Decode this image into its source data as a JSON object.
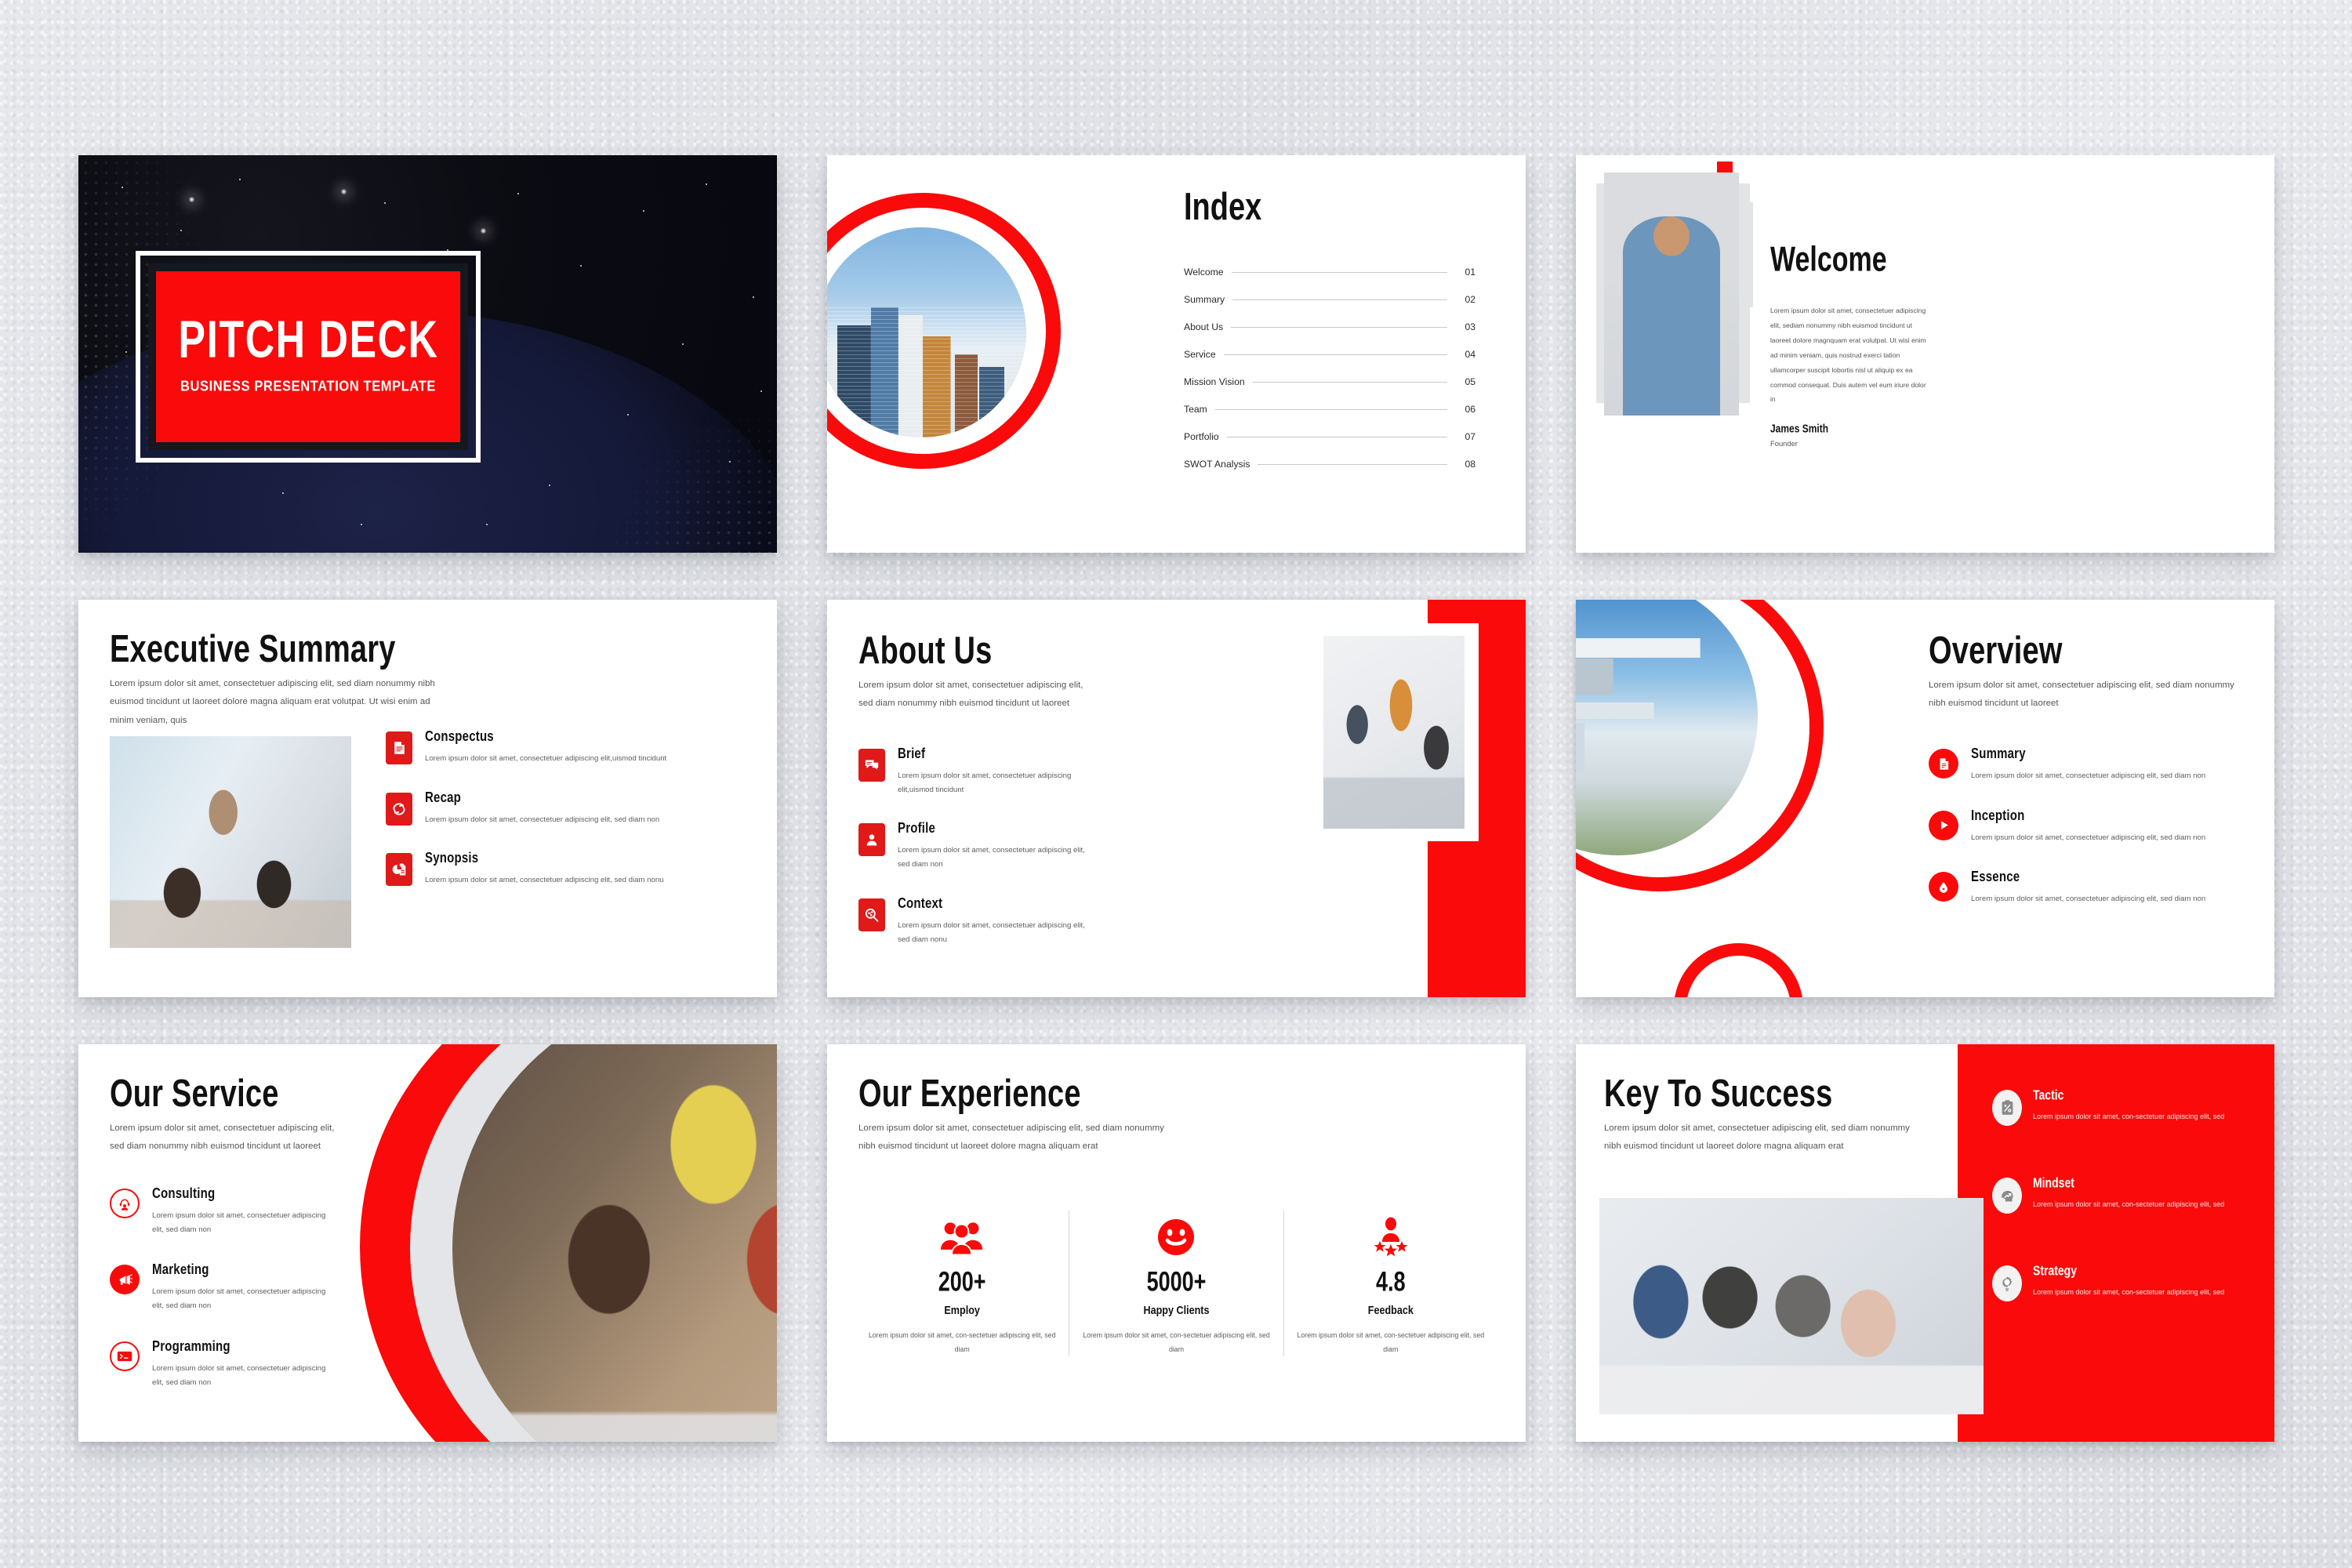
{
  "theme": {
    "red": "#FA0A0A",
    "dark_red": "#E01919",
    "ink": "#111111",
    "body_text": "#555555"
  },
  "slides": {
    "cover": {
      "title": "PITCH DECK",
      "subtitle": "BUSINESS PRESENTATION TEMPLATE"
    },
    "index": {
      "title": "Index",
      "items": [
        {
          "label": "Welcome",
          "number": "01"
        },
        {
          "label": "Summary",
          "number": "02"
        },
        {
          "label": "About Us",
          "number": "03"
        },
        {
          "label": "Service",
          "number": "04"
        },
        {
          "label": "Mission Vision",
          "number": "05"
        },
        {
          "label": "Team",
          "number": "06"
        },
        {
          "label": "Portfolio",
          "number": "07"
        },
        {
          "label": "SWOT Analysis",
          "number": "08"
        }
      ]
    },
    "welcome": {
      "title": "Welcome",
      "body": "Lorem ipsum dolor sit amet, consectetuer adipiscing elit, sediam nonummy nibh euismod tincidunt ut laoreet dolore magnquam erat volutpat. Ut wisi enim ad minim veniam, quis nostrud exerci tation ullamcorper suscipit lobortis nisl ut aliquip ex ea commod consequat. Duis autem vel eum iriure dolor in",
      "name": "James Smith",
      "role": "Founder"
    },
    "executive_summary": {
      "title": "Executive Summary",
      "body": "Lorem ipsum dolor sit amet, consectetuer adipiscing elit, sed diam nonummy nibh euismod tincidunt ut laoreet dolore magna aliquam erat volutpat. Ut wisi enim ad minim veniam, quis",
      "features": [
        {
          "icon": "document-list-icon",
          "title": "Conspectus",
          "text": "Lorem ipsum dolor sit amet, consectetuer adipiscing elit,uismod tincidunt"
        },
        {
          "icon": "refresh-sync-icon",
          "title": "Recap",
          "text": "Lorem ipsum dolor sit amet, consectetuer adipiscing elit, sed diam non"
        },
        {
          "icon": "pie-chart-document-icon",
          "title": "Synopsis",
          "text": "Lorem ipsum dolor sit amet, consectetuer adipiscing elit, sed diam nonu"
        }
      ]
    },
    "about_us": {
      "title": "About Us",
      "body": "Lorem ipsum dolor sit amet, consectetuer adipiscing elit, sed diam nonummy nibh euismod tincidunt ut laoreet",
      "features": [
        {
          "icon": "speech-bubbles-icon",
          "title": "Brief",
          "text": "Lorem ipsum dolor sit amet, consectetuer adipiscing elit,uismod tincidunt"
        },
        {
          "icon": "user-profile-icon",
          "title": "Profile",
          "text": "Lorem ipsum dolor sit amet, consectetuer adipiscing elit, sed diam non"
        },
        {
          "icon": "magnifier-share-icon",
          "title": "Context",
          "text": "Lorem ipsum dolor sit amet, consectetuer adipiscing elit, sed diam nonu"
        }
      ]
    },
    "overview": {
      "title": "Overview",
      "body": "Lorem ipsum dolor sit amet, consectetuer adipiscing elit, sed diam nonummy nibh euismod tincidunt ut laoreet",
      "features": [
        {
          "icon": "document-icon",
          "title": "Summary",
          "text": "Lorem ipsum dolor sit amet, consectetuer adipiscing elit, sed diam non"
        },
        {
          "icon": "play-icon",
          "title": "Inception",
          "text": "Lorem ipsum dolor sit amet, consectetuer adipiscing elit, sed diam non"
        },
        {
          "icon": "water-drop-icon",
          "title": "Essence",
          "text": "Lorem ipsum dolor sit amet, consectetuer adipiscing elit, sed diam non"
        }
      ]
    },
    "our_service": {
      "title": "Our Service",
      "body": "Lorem ipsum dolor sit amet, consectetuer adipiscing elit, sed diam nonummy nibh euismod tincidunt ut laoreet",
      "features": [
        {
          "icon": "headset-support-icon",
          "title": "Consulting",
          "text": "Lorem ipsum dolor sit amet, consectetuer adipiscing elit, sed diam non"
        },
        {
          "icon": "megaphone-icon",
          "title": "Marketing",
          "text": "Lorem ipsum dolor sit amet, consectetuer adipiscing elit, sed diam non"
        },
        {
          "icon": "terminal-code-icon",
          "title": "Programming",
          "text": "Lorem ipsum dolor sit amet, consectetuer adipiscing elit, sed diam non"
        }
      ]
    },
    "our_experience": {
      "title": "Our Experience",
      "body": "Lorem ipsum dolor sit amet, consectetuer adipiscing elit, sed diam nonummy nibh euismod tincidunt ut laoreet dolore magna aliquam erat",
      "stats": [
        {
          "icon": "group-people-icon",
          "value": "200+",
          "label": "Employ",
          "text": "Lorem ipsum dolor sit amet, con-sectetuer adipiscing elit, sed diam"
        },
        {
          "icon": "smiley-face-icon",
          "value": "5000+",
          "label": "Happy Clients",
          "text": "Lorem ipsum dolor sit amet, con-sectetuer adipiscing elit, sed diam"
        },
        {
          "icon": "person-stars-rating-icon",
          "value": "4.8",
          "label": "Feedback",
          "text": "Lorem ipsum dolor sit amet, con-sectetuer adipiscing elit, sed diam"
        }
      ]
    },
    "key_to_success": {
      "title": "Key To Success",
      "body": "Lorem ipsum dolor sit amet, consectetuer adipiscing elit, sed diam nonummy nibh euismod tincidunt ut laoreet dolore magna aliquam erat",
      "features": [
        {
          "icon": "clipboard-tactic-icon",
          "title": "Tactic",
          "text": "Lorem ipsum dolor sit amet, con-sectetuer adipiscing elit, sed"
        },
        {
          "icon": "head-growth-arrow-icon",
          "title": "Mindset",
          "text": "Lorem ipsum dolor sit amet, con-sectetuer adipiscing elit, sed"
        },
        {
          "icon": "lightbulb-gear-icon",
          "title": "Strategy",
          "text": "Lorem ipsum dolor sit amet, con-sectetuer adipiscing elit, sed"
        }
      ]
    }
  }
}
